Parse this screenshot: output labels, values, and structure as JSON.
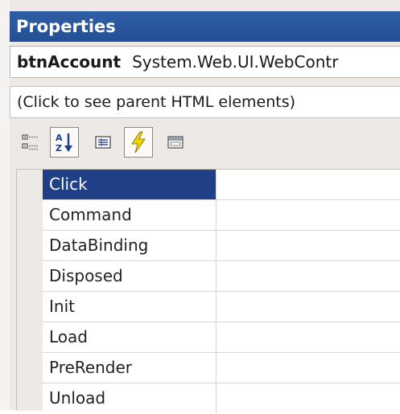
{
  "window": {
    "title": "Properties"
  },
  "object_selector": {
    "name": "btnAccount",
    "type": "System.Web.UI.WebContr"
  },
  "parent_link": {
    "text": "(Click to see parent HTML elements)"
  },
  "toolbar": {
    "buttons": [
      {
        "icon": "categorized-icon",
        "pressed": false
      },
      {
        "icon": "alphabetical-icon",
        "pressed": true
      },
      {
        "icon": "properties-icon",
        "pressed": false
      },
      {
        "icon": "events-icon",
        "pressed": true
      },
      {
        "icon": "property-pages-icon",
        "pressed": false
      }
    ]
  },
  "events": {
    "rows": [
      {
        "name": "Click",
        "value": "",
        "selected": true
      },
      {
        "name": "Command",
        "value": ""
      },
      {
        "name": "DataBinding",
        "value": ""
      },
      {
        "name": "Disposed",
        "value": ""
      },
      {
        "name": "Init",
        "value": ""
      },
      {
        "name": "Load",
        "value": ""
      },
      {
        "name": "PreRender",
        "value": ""
      },
      {
        "name": "Unload",
        "value": ""
      }
    ]
  },
  "colors": {
    "title_bar": "#244f94",
    "selection": "#1f3f86",
    "lightning": "#f2d600"
  }
}
